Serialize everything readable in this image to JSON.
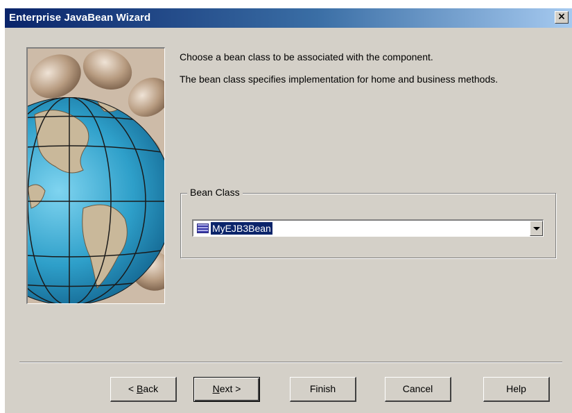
{
  "window": {
    "title": "Enterprise JavaBean Wizard",
    "close_label": "×"
  },
  "instructions": {
    "line1": "Choose a bean class to be associated with the component.",
    "line2": "The bean class specifies implementation for home and business methods."
  },
  "bean_class": {
    "group_label": "Bean Class",
    "selected_value": "MyEJB3Bean",
    "icon": "class-icon"
  },
  "buttons": {
    "back": {
      "prefix": "< ",
      "mnemonic": "B",
      "rest": "ack"
    },
    "next": {
      "mnemonic": "N",
      "rest": "ext >"
    },
    "finish": "Finish",
    "cancel": "Cancel",
    "help": "Help"
  },
  "colors": {
    "titlebar_start": "#0a246a",
    "titlebar_end": "#a6caf0",
    "dialog_bg": "#d4d0c8",
    "selection_bg": "#0a246a"
  }
}
